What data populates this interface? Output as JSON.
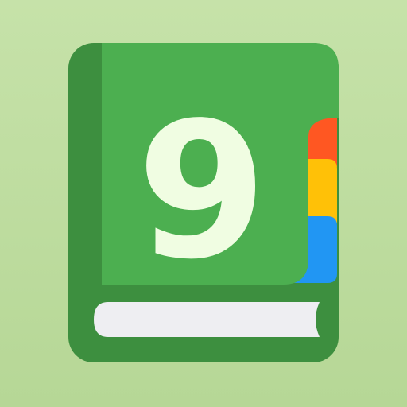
{
  "app_icon": {
    "digit": "9",
    "icon_name": "book-with-bookmark-tabs",
    "colors": {
      "background": "#c0dfa2",
      "book_cover_dark": "#3d8f3f",
      "book_cover_front": "#4caf50",
      "pages": "#eeeef2",
      "digit_fill": "#f0fde2",
      "tab_red": "#ff5722",
      "tab_yellow": "#ffc107",
      "tab_blue": "#2196f3"
    }
  }
}
